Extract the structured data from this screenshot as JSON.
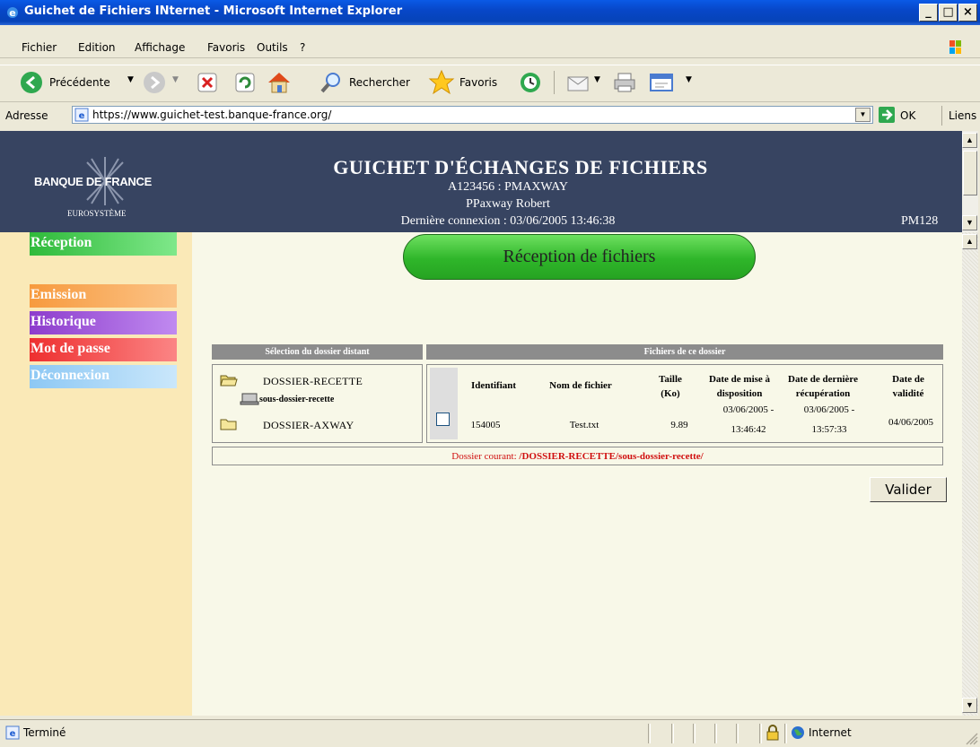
{
  "window": {
    "title": "Guichet de Fichiers INternet - Microsoft Internet Explorer"
  },
  "menu": {
    "items": [
      "Fichier",
      "Edition",
      "Affichage",
      "Favoris",
      "Outils",
      "?"
    ]
  },
  "toolbar": {
    "back_label": "Précédente",
    "search_label": "Rechercher",
    "favorites_label": "Favoris"
  },
  "addressbar": {
    "label": "Adresse",
    "url": "https://www.guichet-test.banque-france.org/",
    "go_label": "OK",
    "links_label": "Liens"
  },
  "header": {
    "logo_line1": "BANQUE DE FRANCE",
    "logo_line2": "EUROSYSTÈME",
    "title": "GUICHET D'ÉCHANGES DE FICHIERS",
    "user_id": "A123456 : PMAXWAY",
    "user_name": "PPaxway Robert",
    "last_login": "Dernière connexion : 03/06/2005 13:46:38",
    "code": "PM128"
  },
  "nav": {
    "items": [
      {
        "label": "Réception",
        "color": "#3cc44a"
      },
      {
        "label": "Emission",
        "color": "#f7a14c"
      },
      {
        "label": "Historique",
        "color": "#9b4fd6"
      },
      {
        "label": "Mot de passe",
        "color": "#f23d3d"
      },
      {
        "label": "Déconnexion",
        "color": "#9fd2f6"
      }
    ]
  },
  "main": {
    "section_title": "Réception de fichiers",
    "left_header": "Sélection du dossier distant",
    "right_header": "Fichiers de ce dossier",
    "folders": [
      {
        "name": "DOSSIER-RECETTE"
      },
      {
        "name": "sous-dossier-recette"
      },
      {
        "name": "DOSSIER-AXWAY"
      }
    ],
    "columns": [
      "Identifiant",
      "Nom de fichier",
      "Taille (Ko)",
      "Date de mise à disposition",
      "Date de dernière récupération",
      "Date de validité"
    ],
    "rows": [
      {
        "id": "154005",
        "filename": "Test.txt",
        "size": "9.89",
        "available_date_a": "03/06/2005 -",
        "available_date_b": "13:46:42",
        "retrieved_date_a": "03/06/2005 -",
        "retrieved_date_b": "13:57:33",
        "validity": "04/06/2005"
      }
    ],
    "current_folder_label": "Dossier courant: ",
    "current_folder_path": "/DOSSIER-RECETTE/sous-dossier-recette/",
    "submit_label": "Valider"
  },
  "status": {
    "text": "Terminé",
    "zone": "Internet"
  }
}
